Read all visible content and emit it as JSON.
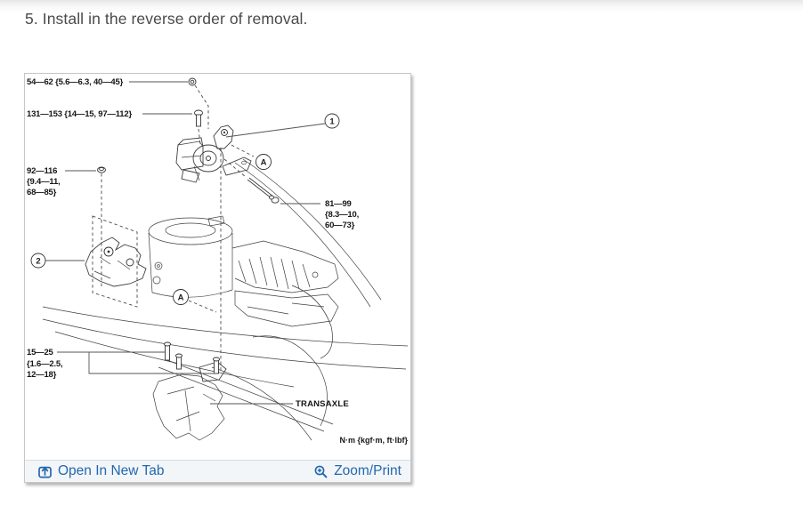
{
  "page": {
    "heading": "5. Install in the reverse order of removal."
  },
  "viewer": {
    "toolbar": {
      "open_in_new_tab": "Open In New Tab",
      "zoom_print": "Zoom/Print",
      "link_color": "#2368ad"
    },
    "diagram": {
      "torque_specs": [
        {
          "name": "upper-mount-nut",
          "lines": [
            "54—62 {5.6—6.3, 40—45}"
          ]
        },
        {
          "name": "mount-through-bolt",
          "lines": [
            "131—153 {14—15, 97—112}"
          ]
        },
        {
          "name": "mount-stud-nut",
          "lines": [
            "92—116",
            "{9.4—11,",
            "68—85}"
          ]
        },
        {
          "name": "side-long-bolt",
          "lines": [
            "81—99",
            "{8.3—10,",
            "60—73}"
          ]
        },
        {
          "name": "bracket-bolts",
          "lines": [
            "15—25",
            "{1.6—2.5,",
            "12—18}"
          ]
        }
      ],
      "callouts": {
        "one": "1",
        "two": "2",
        "a": "A"
      },
      "part_label": "TRANSAXLE",
      "units_note": "N·m {kgf·m, ft·lbf}"
    }
  }
}
